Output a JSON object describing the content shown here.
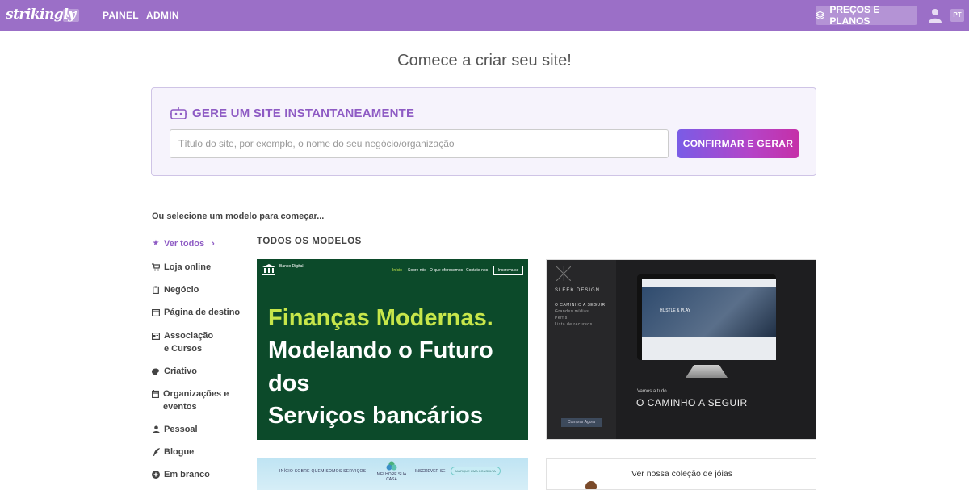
{
  "nav": {
    "logo": "strikingly",
    "vip_badge": "VIP",
    "links": [
      "PAINEL",
      "ADMIN"
    ],
    "pricing_label": "PREÇOS E PLANOS",
    "lang_badge": "PT",
    "color": "#9b6fc7"
  },
  "headline": "Comece a criar seu site!",
  "generator": {
    "title": "GERE UM SITE INSTANTANEAMENTE",
    "placeholder": "Título do site, por exemplo, o nome do seu negócio/organização",
    "button": "CONFIRMAR E GERAR"
  },
  "select_label": "Ou selecione um modelo para começar...",
  "sidebar": {
    "items": [
      {
        "label": "Ver todos",
        "icon": "star-icon",
        "active": true
      },
      {
        "label": "Loja online",
        "icon": "cart-icon"
      },
      {
        "label": "Negócio",
        "icon": "clipboard-icon"
      },
      {
        "label": "Página de destino",
        "icon": "window-icon"
      },
      {
        "label": "Associação e Cursos",
        "icon": "id-card-icon"
      },
      {
        "label": "Criativo",
        "icon": "palette-icon"
      },
      {
        "label": "Organizações e eventos",
        "icon": "calendar-icon"
      },
      {
        "label": "Pessoal",
        "icon": "person-icon"
      },
      {
        "label": "Blogue",
        "icon": "quill-icon"
      },
      {
        "label": "Em branco",
        "icon": "plus-circle-icon"
      }
    ]
  },
  "section_title": "TODOS OS MODELOS",
  "templates": {
    "bank": {
      "brand": "Banco Digital.",
      "nav": [
        "Início",
        "Sobre nós",
        "O que oferecemos",
        "Contate-nos"
      ],
      "cta": "Inscreva-se",
      "headline_1": "Finanças Modernas.",
      "headline_2": "Modelando o Futuro",
      "headline_3": "dos",
      "headline_4": "Serviços bancários"
    },
    "sleek": {
      "brand": "SLEEK DESIGN",
      "menu": [
        "O CAMINHO A SEGUIR",
        "Grandes mídias",
        "Perfis",
        "Lista de recursos"
      ],
      "screen_text": "HUSTLE & PLAY",
      "sub": "Vamos a tudo",
      "heading": "O CAMINHO A SEGUIR",
      "button": "Comprar Agora"
    },
    "house": {
      "nav": "INÍCIO   SOBRE   QUEM SOMOS   SERVIÇOS",
      "logo": "MELHORE SUA CASA",
      "subscribe": "INSCREVER-SE",
      "button": "MARQUE UMA CONSULTA"
    },
    "jewelry": {
      "text": "Ver nossa coleção de jóias"
    }
  }
}
